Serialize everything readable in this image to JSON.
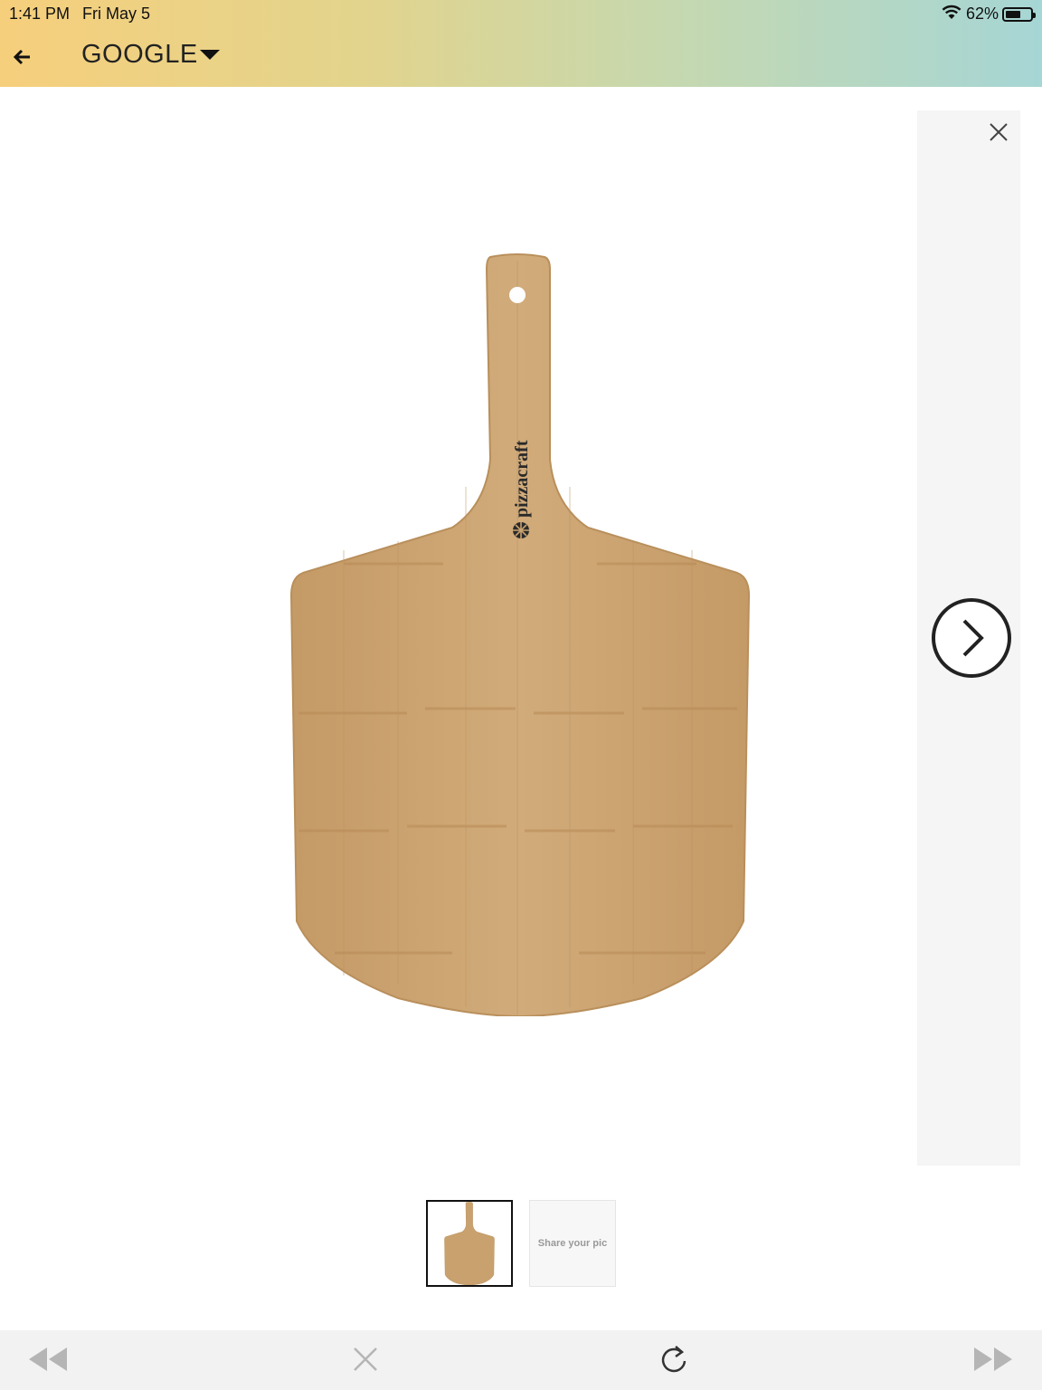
{
  "status_bar": {
    "time": "1:41 PM",
    "date": "Fri May 5",
    "battery": "62%",
    "battery_level": 0.62,
    "icons": [
      "wifi-icon",
      "battery-icon"
    ]
  },
  "header": {
    "back_icon": "arrow-left-icon",
    "title": "GOOGLE",
    "dropdown_icon": "caret-down-icon"
  },
  "viewer": {
    "close_icon": "close-icon",
    "next_icon": "chevron-right-circle-icon",
    "product": {
      "brand_mark": "pizzacraft",
      "description": "bamboo pizza peel"
    },
    "thumbnails": [
      {
        "kind": "image"
      },
      {
        "label": "Share your pic"
      }
    ]
  },
  "toolbar": {
    "items": [
      {
        "icon": "rewind-icon"
      },
      {
        "icon": "close-icon"
      },
      {
        "icon": "refresh-icon"
      },
      {
        "icon": "fast-forward-icon"
      }
    ]
  },
  "colors": {
    "header_gradient_start": "#f6cf7c",
    "header_gradient_end": "#a6d6d5",
    "wood": "#c8a16e",
    "toolbar_bg": "#f2f2f2",
    "toolbar_icon": "#b5b5b5"
  }
}
